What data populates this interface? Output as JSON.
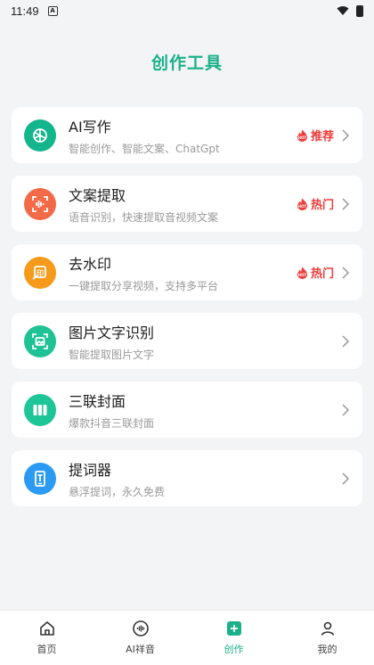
{
  "status": {
    "time": "11:49",
    "notif_icon": "A"
  },
  "page": {
    "title": "创作工具"
  },
  "colors": {
    "accent": "#1ab089",
    "hot": "#ee3b3b"
  },
  "cards": [
    {
      "title": "AI写作",
      "subtitle": "智能创作、智能文案、ChatGpt",
      "badge": "推荐",
      "icon": "openai-icon",
      "icon_bg": "#13b58c"
    },
    {
      "title": "文案提取",
      "subtitle": "语音识别，快速提取音视频文案",
      "badge": "热门",
      "icon": "voice-scan-icon",
      "icon_bg": "#f26a47"
    },
    {
      "title": "去水印",
      "subtitle": "一键提取分享视频，支持多平台",
      "badge": "热门",
      "icon": "stamp-icon",
      "icon_bg": "#f59a1a"
    },
    {
      "title": "图片文字识别",
      "subtitle": "智能提取图片文字",
      "badge": "",
      "icon": "image-scan-icon",
      "icon_bg": "#1fc294"
    },
    {
      "title": "三联封面",
      "subtitle": "爆款抖音三联封面",
      "badge": "",
      "icon": "triptych-icon",
      "icon_bg": "#1ec596"
    },
    {
      "title": "提词器",
      "subtitle": "悬浮提词，永久免费",
      "badge": "",
      "icon": "teleprompter-icon",
      "icon_bg": "#2b9af3"
    }
  ],
  "nav": [
    {
      "label": "首页",
      "icon": "home-icon",
      "active": false
    },
    {
      "label": "AI祥音",
      "icon": "voice-icon",
      "active": false
    },
    {
      "label": "创作",
      "icon": "create-icon",
      "active": true
    },
    {
      "label": "我的",
      "icon": "profile-icon",
      "active": false
    }
  ]
}
